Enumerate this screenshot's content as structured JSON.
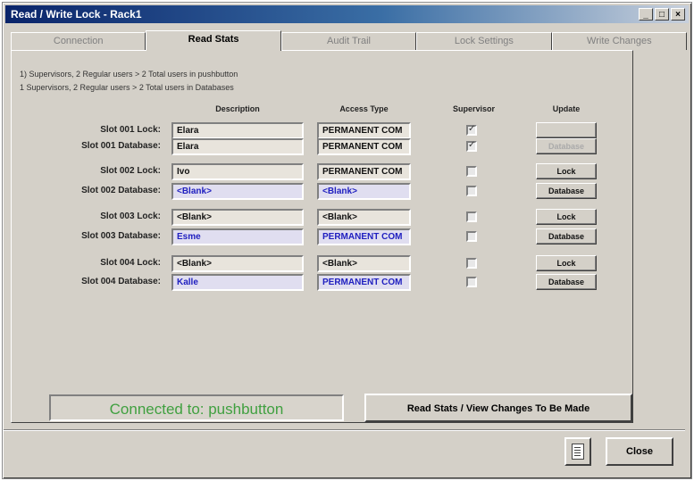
{
  "window": {
    "title": "Read / Write Lock - Rack1"
  },
  "tabs": [
    {
      "label": "Connection"
    },
    {
      "label": "Read Stats"
    },
    {
      "label": "Audit Trail"
    },
    {
      "label": "Lock Settings"
    },
    {
      "label": "Write Changes"
    }
  ],
  "legend": {
    "line1": "1) Supervisors, 2 Regular users > 2 Total users in pushbutton",
    "line2": "1 Supervisors, 2 Regular users > 2 Total users in Databases"
  },
  "headers": {
    "description": "Description",
    "access_type": "Access Type",
    "supervisor": "Supervisor",
    "update": "Update"
  },
  "rows": [
    {
      "label": "Slot 001 Lock:",
      "description": "Elara",
      "access": "PERMANENT COM",
      "supervisor": true,
      "button": "",
      "kind": "lock",
      "button_disabled": true
    },
    {
      "label": "Slot 001 Database:",
      "description": "Elara",
      "access": "PERMANENT COM",
      "supervisor": true,
      "button": "Database",
      "kind": "lock",
      "button_disabled": true
    },
    {
      "label": "Slot 002 Lock:",
      "description": "Ivo",
      "access": "PERMANENT COM",
      "supervisor": false,
      "button": "Lock",
      "kind": "lock",
      "button_disabled": false
    },
    {
      "label": "Slot 002 Database:",
      "description": "<Blank>",
      "access": "<Blank>",
      "supervisor": false,
      "button": "Database",
      "kind": "db",
      "button_disabled": false
    },
    {
      "label": "Slot 003 Lock:",
      "description": "<Blank>",
      "access": "<Blank>",
      "supervisor": false,
      "button": "Lock",
      "kind": "lock",
      "button_disabled": false
    },
    {
      "label": "Slot 003 Database:",
      "description": "Esme",
      "access": "PERMANENT COM",
      "supervisor": false,
      "button": "Database",
      "kind": "db",
      "button_disabled": false
    },
    {
      "label": "Slot 004 Lock:",
      "description": "<Blank>",
      "access": "<Blank>",
      "supervisor": false,
      "button": "Lock",
      "kind": "lock",
      "button_disabled": false
    },
    {
      "label": "Slot 004 Database:",
      "description": "Kalle",
      "access": "PERMANENT COM",
      "supervisor": false,
      "button": "Database",
      "kind": "db",
      "button_disabled": false
    }
  ],
  "status": {
    "text": "Connected to: pushbutton"
  },
  "actions": {
    "read_stats": "Read Stats / View Changes To Be Made",
    "close": "Close"
  },
  "colors": {
    "status_text": "#40a040",
    "db_text": "#2020c0",
    "title_bar": "#0a246a"
  }
}
